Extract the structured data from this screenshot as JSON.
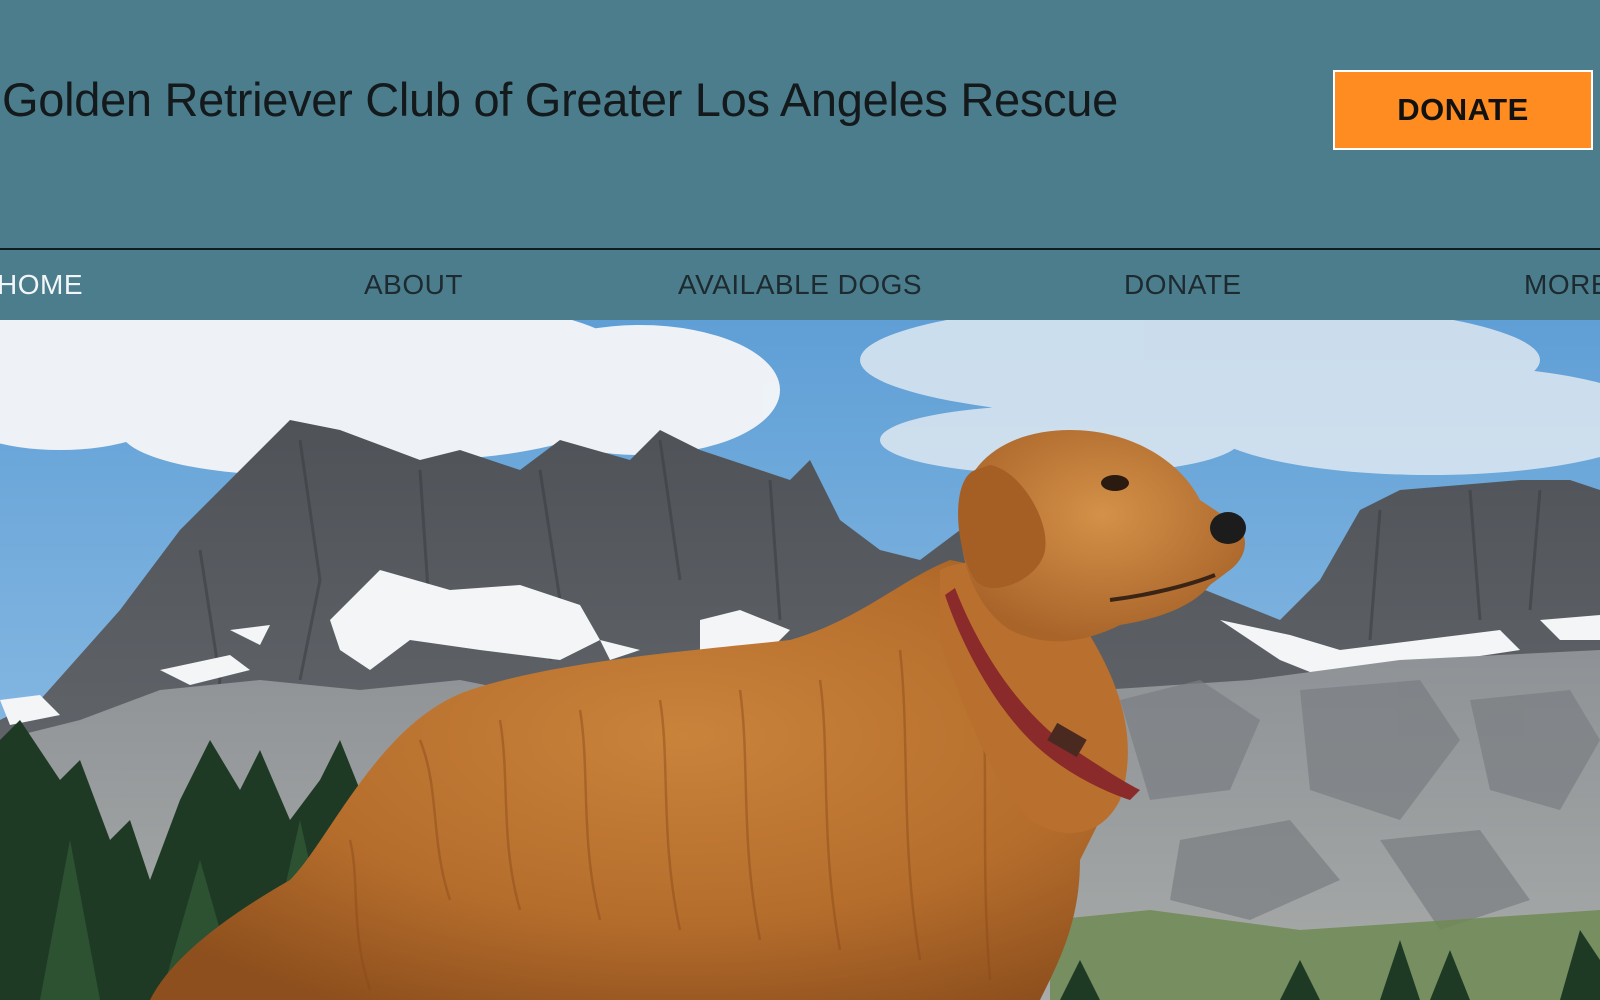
{
  "header": {
    "site_title": "Golden Retriever Club of Greater Los Angeles Rescue",
    "donate_button": "DONATE"
  },
  "nav": {
    "items": [
      {
        "label": "HOME"
      },
      {
        "label": "ABOUT"
      },
      {
        "label": "AVAILABLE DOGS"
      },
      {
        "label": "DONATE"
      },
      {
        "label": "MORE"
      }
    ]
  },
  "colors": {
    "header_bg": "#4b7d8d",
    "donate_bg": "#ff8c20",
    "nav_active": "#f2f6f8",
    "nav_text": "#1d2a30"
  },
  "hero": {
    "icon": "golden-retriever-mountain-photo"
  }
}
